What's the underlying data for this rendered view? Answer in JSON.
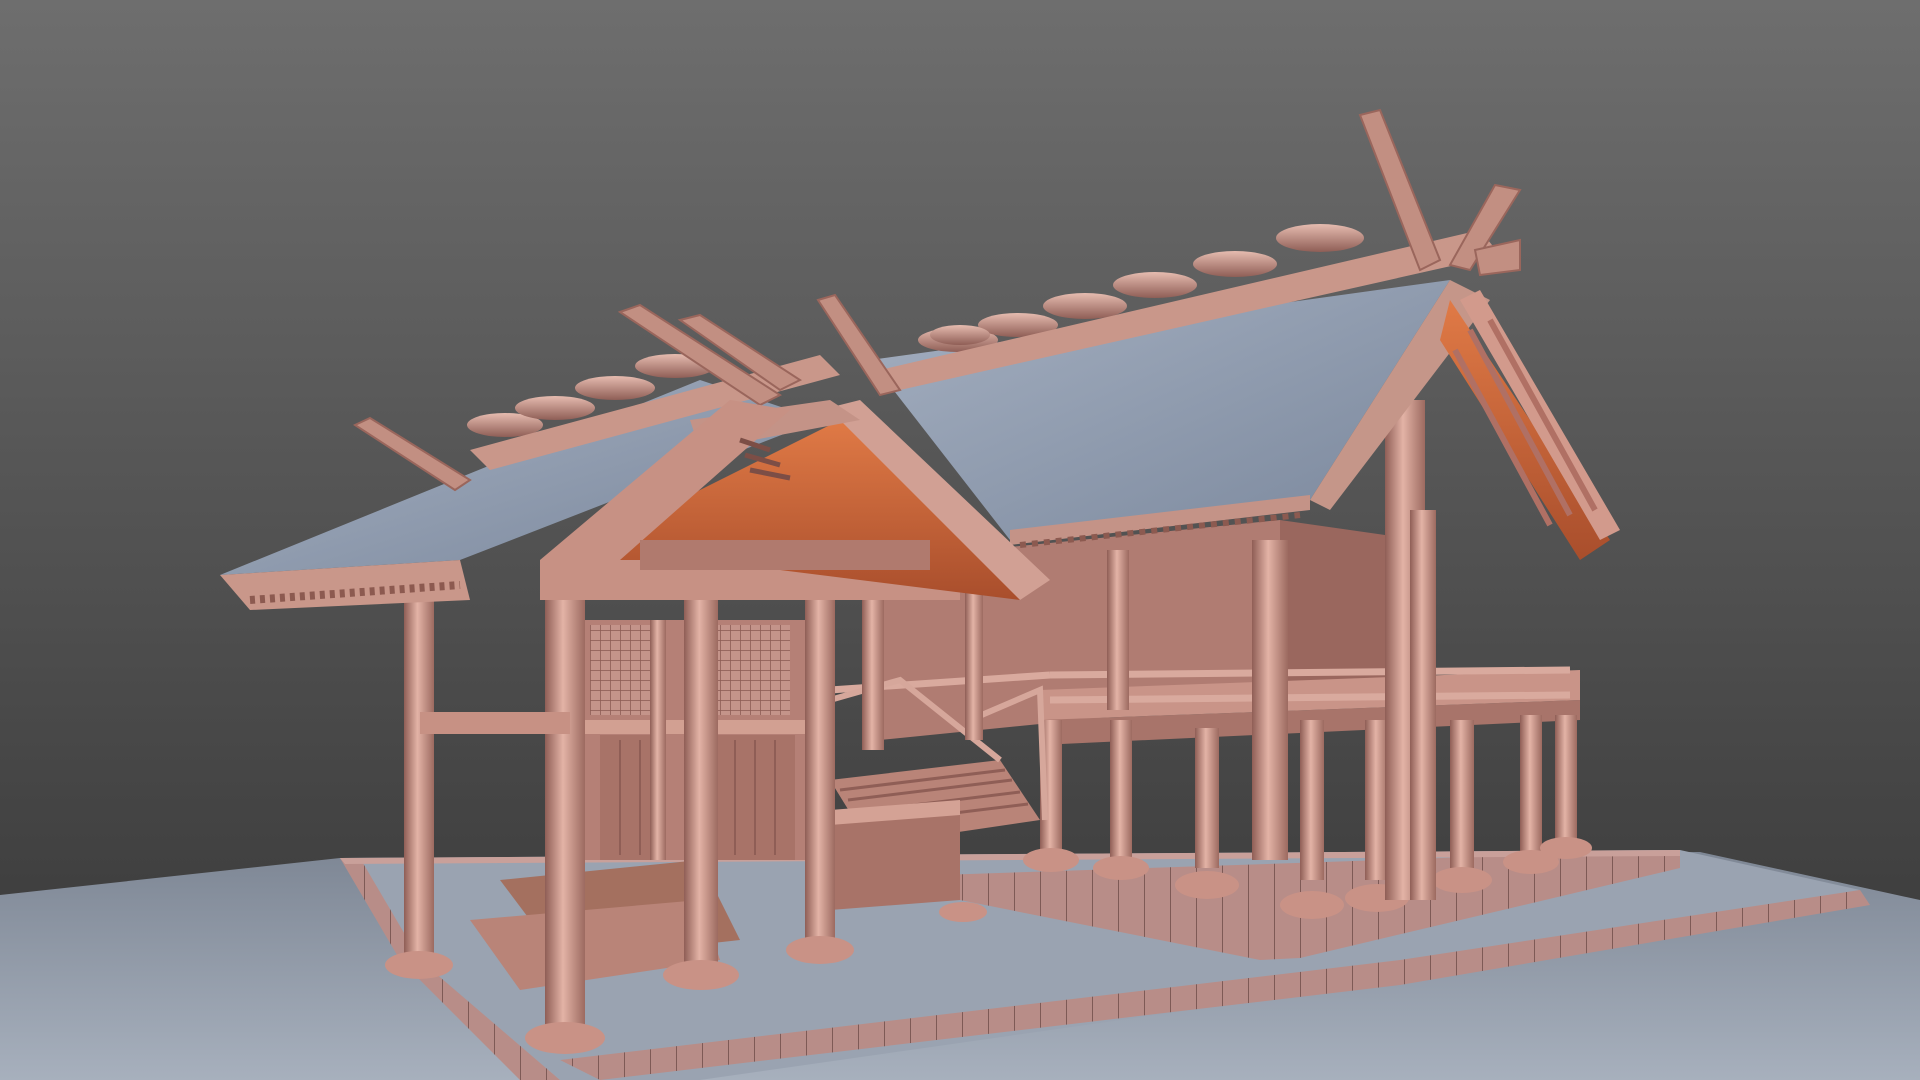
{
  "scene": {
    "subject": "shinto-shrine-3d-model",
    "colors": {
      "background_top": "#6e6e6e",
      "background_bottom": "#3b3b3b",
      "ground": "#8f98a6",
      "ground_far": "#a3acb9",
      "stone_border": "#b58a86",
      "wood_light": "#d7a598",
      "wood_mid": "#b98478",
      "wood_dark": "#8f5e56",
      "roof_top": "#8d9aae",
      "roof_top_light": "#a9b4c5",
      "roof_underside": "#d06a3c",
      "roof_underside_dark": "#a84f2d"
    }
  }
}
